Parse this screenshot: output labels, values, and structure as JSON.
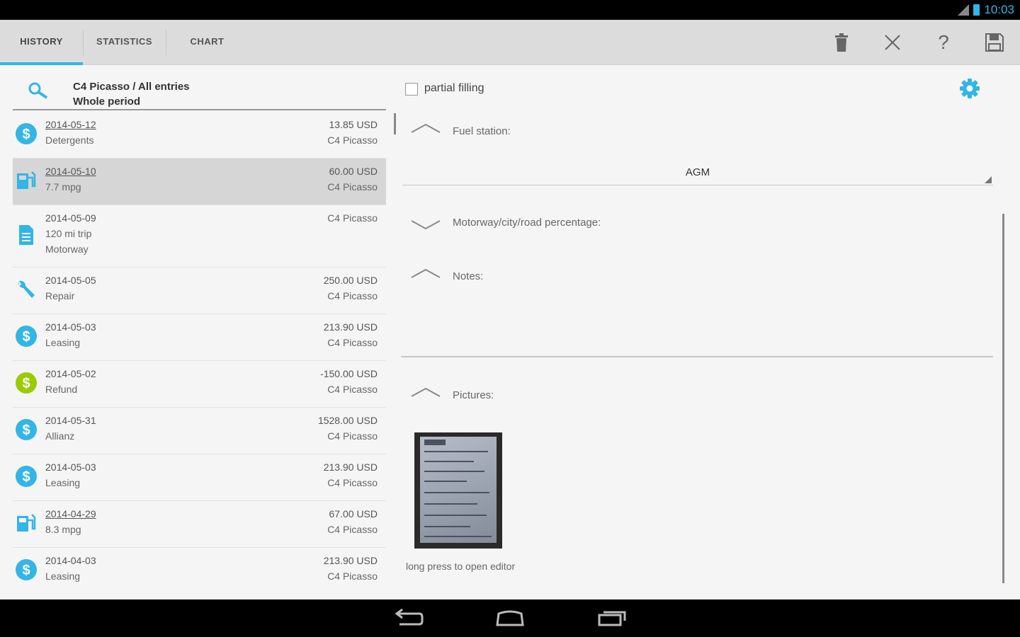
{
  "status": {
    "time": "10:03"
  },
  "tabs": [
    {
      "label": "HISTORY",
      "active": true
    },
    {
      "label": "STATISTICS",
      "active": false
    },
    {
      "label": "CHART",
      "active": false
    }
  ],
  "toolbar": {
    "icons": [
      "trash-icon",
      "close-icon",
      "help-icon",
      "save-icon"
    ],
    "help_label": "?"
  },
  "filter": {
    "line1": "C4 Picasso / All entries",
    "line2": "Whole period"
  },
  "entries": [
    {
      "date": "2014-05-12",
      "sub": "Detergents",
      "amount": "13.85 USD",
      "car": "C4 Picasso",
      "icon": "dollar",
      "underline": true
    },
    {
      "date": "2014-05-10",
      "sub": "7.7 mpg",
      "amount": "60.00 USD",
      "car": "C4 Picasso",
      "icon": "fuel",
      "underline": true,
      "selected": true
    },
    {
      "date": "2014-05-09",
      "sub": "120 mi trip",
      "sub2": "Motorway",
      "amount": "",
      "car": "C4 Picasso",
      "icon": "note"
    },
    {
      "date": "2014-05-05",
      "sub": "Repair",
      "amount": "250.00 USD",
      "car": "C4 Picasso",
      "icon": "wrench"
    },
    {
      "date": "2014-05-03",
      "sub": "Leasing",
      "amount": "213.90 USD",
      "car": "C4 Picasso",
      "icon": "dollar"
    },
    {
      "date": "2014-05-02",
      "sub": "Refund",
      "amount": "-150.00 USD",
      "car": "C4 Picasso",
      "icon": "dollar-green"
    },
    {
      "date": "2014-05-31",
      "sub": "Allianz",
      "amount": "1528.00 USD",
      "car": "C4 Picasso",
      "icon": "dollar"
    },
    {
      "date": "2014-05-03",
      "sub": "Leasing",
      "amount": "213.90 USD",
      "car": "C4 Picasso",
      "icon": "dollar"
    },
    {
      "date": "2014-04-29",
      "sub": "8.3 mpg",
      "amount": "67.00 USD",
      "car": "C4 Picasso",
      "icon": "fuel",
      "underline": true
    },
    {
      "date": "2014-04-03",
      "sub": "Leasing",
      "amount": "213.90 USD",
      "car": "C4 Picasso",
      "icon": "dollar"
    }
  ],
  "detail": {
    "partial_filling": "partial filling",
    "partial_checked": false,
    "fuel_station_label": "Fuel station:",
    "fuel_station_value": "AGM",
    "motorway_label": "Motorway/city/road percentage:",
    "notes_label": "Notes:",
    "pictures_label": "Pictures:",
    "picture_caption": "long press to open editor"
  },
  "colors": {
    "accent": "#33b5e5",
    "green": "#99cc00",
    "actionbar": "#dcdcdc"
  }
}
